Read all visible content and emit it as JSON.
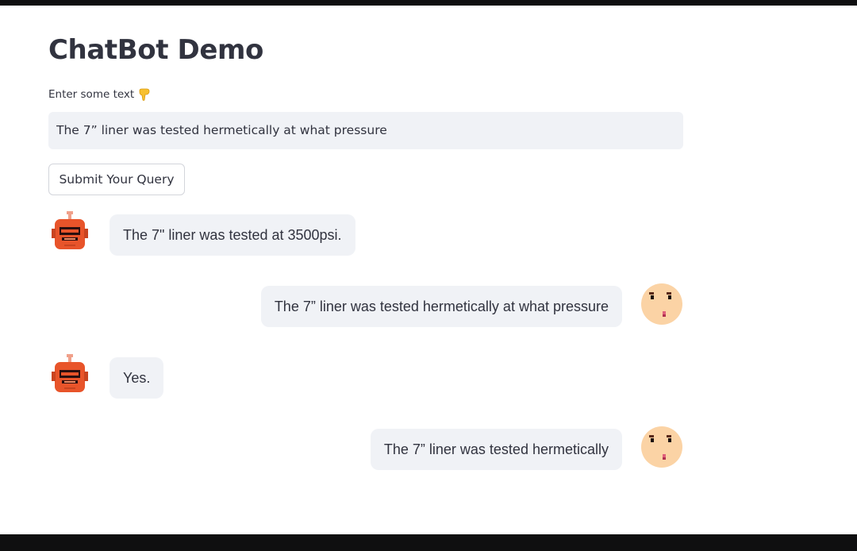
{
  "app": {
    "title": "ChatBot Demo"
  },
  "input": {
    "label": "Enter some text",
    "label_icon": "backhand-index-pointing-down-icon",
    "value": "The 7” liner was tested hermetically at what pressure"
  },
  "submit_button": {
    "label": "Submit Your Query"
  },
  "messages": [
    {
      "sender": "bot",
      "avatar": "robot-avatar-icon",
      "text": "The 7\" liner was tested at 3500psi."
    },
    {
      "sender": "user",
      "avatar": "face-avatar-icon",
      "text": "The 7” liner was tested hermetically at what pressure"
    },
    {
      "sender": "bot",
      "avatar": "robot-avatar-icon",
      "text": "Yes."
    },
    {
      "sender": "user",
      "avatar": "face-avatar-icon",
      "text": "The 7” liner was tested hermetically"
    }
  ],
  "colors": {
    "text": "#31333f",
    "bubble_bg": "#f0f2f6",
    "robot_body": "#e8542a",
    "face_skin": "#fbd3a5",
    "frame": "#0f0f10"
  }
}
